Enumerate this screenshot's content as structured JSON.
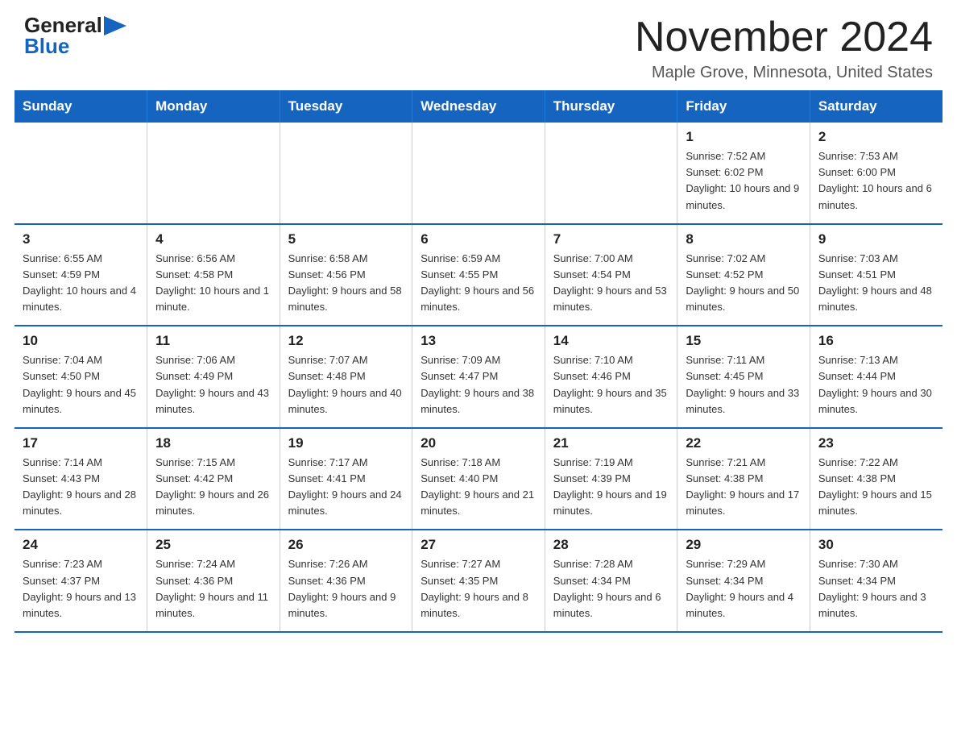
{
  "header": {
    "logo_general": "General",
    "logo_blue": "Blue",
    "month_title": "November 2024",
    "location": "Maple Grove, Minnesota, United States"
  },
  "days_of_week": [
    "Sunday",
    "Monday",
    "Tuesday",
    "Wednesday",
    "Thursday",
    "Friday",
    "Saturday"
  ],
  "weeks": [
    [
      {
        "day": "",
        "info": ""
      },
      {
        "day": "",
        "info": ""
      },
      {
        "day": "",
        "info": ""
      },
      {
        "day": "",
        "info": ""
      },
      {
        "day": "",
        "info": ""
      },
      {
        "day": "1",
        "info": "Sunrise: 7:52 AM\nSunset: 6:02 PM\nDaylight: 10 hours and 9 minutes."
      },
      {
        "day": "2",
        "info": "Sunrise: 7:53 AM\nSunset: 6:00 PM\nDaylight: 10 hours and 6 minutes."
      }
    ],
    [
      {
        "day": "3",
        "info": "Sunrise: 6:55 AM\nSunset: 4:59 PM\nDaylight: 10 hours and 4 minutes."
      },
      {
        "day": "4",
        "info": "Sunrise: 6:56 AM\nSunset: 4:58 PM\nDaylight: 10 hours and 1 minute."
      },
      {
        "day": "5",
        "info": "Sunrise: 6:58 AM\nSunset: 4:56 PM\nDaylight: 9 hours and 58 minutes."
      },
      {
        "day": "6",
        "info": "Sunrise: 6:59 AM\nSunset: 4:55 PM\nDaylight: 9 hours and 56 minutes."
      },
      {
        "day": "7",
        "info": "Sunrise: 7:00 AM\nSunset: 4:54 PM\nDaylight: 9 hours and 53 minutes."
      },
      {
        "day": "8",
        "info": "Sunrise: 7:02 AM\nSunset: 4:52 PM\nDaylight: 9 hours and 50 minutes."
      },
      {
        "day": "9",
        "info": "Sunrise: 7:03 AM\nSunset: 4:51 PM\nDaylight: 9 hours and 48 minutes."
      }
    ],
    [
      {
        "day": "10",
        "info": "Sunrise: 7:04 AM\nSunset: 4:50 PM\nDaylight: 9 hours and 45 minutes."
      },
      {
        "day": "11",
        "info": "Sunrise: 7:06 AM\nSunset: 4:49 PM\nDaylight: 9 hours and 43 minutes."
      },
      {
        "day": "12",
        "info": "Sunrise: 7:07 AM\nSunset: 4:48 PM\nDaylight: 9 hours and 40 minutes."
      },
      {
        "day": "13",
        "info": "Sunrise: 7:09 AM\nSunset: 4:47 PM\nDaylight: 9 hours and 38 minutes."
      },
      {
        "day": "14",
        "info": "Sunrise: 7:10 AM\nSunset: 4:46 PM\nDaylight: 9 hours and 35 minutes."
      },
      {
        "day": "15",
        "info": "Sunrise: 7:11 AM\nSunset: 4:45 PM\nDaylight: 9 hours and 33 minutes."
      },
      {
        "day": "16",
        "info": "Sunrise: 7:13 AM\nSunset: 4:44 PM\nDaylight: 9 hours and 30 minutes."
      }
    ],
    [
      {
        "day": "17",
        "info": "Sunrise: 7:14 AM\nSunset: 4:43 PM\nDaylight: 9 hours and 28 minutes."
      },
      {
        "day": "18",
        "info": "Sunrise: 7:15 AM\nSunset: 4:42 PM\nDaylight: 9 hours and 26 minutes."
      },
      {
        "day": "19",
        "info": "Sunrise: 7:17 AM\nSunset: 4:41 PM\nDaylight: 9 hours and 24 minutes."
      },
      {
        "day": "20",
        "info": "Sunrise: 7:18 AM\nSunset: 4:40 PM\nDaylight: 9 hours and 21 minutes."
      },
      {
        "day": "21",
        "info": "Sunrise: 7:19 AM\nSunset: 4:39 PM\nDaylight: 9 hours and 19 minutes."
      },
      {
        "day": "22",
        "info": "Sunrise: 7:21 AM\nSunset: 4:38 PM\nDaylight: 9 hours and 17 minutes."
      },
      {
        "day": "23",
        "info": "Sunrise: 7:22 AM\nSunset: 4:38 PM\nDaylight: 9 hours and 15 minutes."
      }
    ],
    [
      {
        "day": "24",
        "info": "Sunrise: 7:23 AM\nSunset: 4:37 PM\nDaylight: 9 hours and 13 minutes."
      },
      {
        "day": "25",
        "info": "Sunrise: 7:24 AM\nSunset: 4:36 PM\nDaylight: 9 hours and 11 minutes."
      },
      {
        "day": "26",
        "info": "Sunrise: 7:26 AM\nSunset: 4:36 PM\nDaylight: 9 hours and 9 minutes."
      },
      {
        "day": "27",
        "info": "Sunrise: 7:27 AM\nSunset: 4:35 PM\nDaylight: 9 hours and 8 minutes."
      },
      {
        "day": "28",
        "info": "Sunrise: 7:28 AM\nSunset: 4:34 PM\nDaylight: 9 hours and 6 minutes."
      },
      {
        "day": "29",
        "info": "Sunrise: 7:29 AM\nSunset: 4:34 PM\nDaylight: 9 hours and 4 minutes."
      },
      {
        "day": "30",
        "info": "Sunrise: 7:30 AM\nSunset: 4:34 PM\nDaylight: 9 hours and 3 minutes."
      }
    ]
  ]
}
